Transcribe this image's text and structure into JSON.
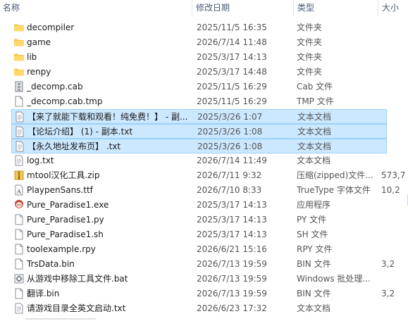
{
  "columns": {
    "name": "名称",
    "date": "修改日期",
    "type": "类型",
    "size": "大小"
  },
  "files": [
    {
      "name": "decompiler",
      "date": "2025/11/5 16:35",
      "type": "文件夹",
      "size": "",
      "icon": "folder-icon",
      "selected": false
    },
    {
      "name": "game",
      "date": "2026/7/14 11:48",
      "type": "文件夹",
      "size": "",
      "icon": "folder-icon",
      "selected": false
    },
    {
      "name": "lib",
      "date": "2025/3/17 14:13",
      "type": "文件夹",
      "size": "",
      "icon": "folder-icon",
      "selected": false
    },
    {
      "name": "renpy",
      "date": "2025/3/17 14:48",
      "type": "文件夹",
      "size": "",
      "icon": "folder-icon",
      "selected": false
    },
    {
      "name": "_decomp.cab",
      "date": "2025/11/5 16:29",
      "type": "Cab 文件",
      "size": "",
      "icon": "cab-archive-icon",
      "selected": false
    },
    {
      "name": "_decomp.cab.tmp",
      "date": "2025/11/5 16:29",
      "type": "TMP 文件",
      "size": "",
      "icon": "file-icon",
      "selected": false
    },
    {
      "name": "【来了就能下载和观看！纯免费！】 - 副...",
      "date": "2025/3/26 1:07",
      "type": "文本文档",
      "size": "",
      "icon": "text-document-icon",
      "selected": true
    },
    {
      "name": "【论坛介绍】 (1) - 副本.txt",
      "date": "2025/3/26 1:08",
      "type": "文本文档",
      "size": "",
      "icon": "text-document-icon",
      "selected": true
    },
    {
      "name": "【永久地址发布页】 .txt",
      "date": "2025/3/26 1:08",
      "type": "文本文档",
      "size": "",
      "icon": "text-document-icon",
      "selected": true
    },
    {
      "name": "log.txt",
      "date": "2026/7/14 11:49",
      "type": "文本文档",
      "size": "",
      "icon": "text-document-icon",
      "selected": false
    },
    {
      "name": "mtool汉化工具.zip",
      "date": "2026/7/11 9:32",
      "type": "压缩(zipped)文件...",
      "size": "573,7",
      "icon": "zip-folder-icon",
      "selected": false
    },
    {
      "name": "PlaypenSans.ttf",
      "date": "2026/7/10 8:33",
      "type": "TrueType 字体文件",
      "size": "10,2",
      "icon": "font-file-icon",
      "selected": false
    },
    {
      "name": "Pure_Paradise1.exe",
      "date": "2025/3/17 14:13",
      "type": "应用程序",
      "size": "",
      "icon": "app-character-icon",
      "selected": false
    },
    {
      "name": "Pure_Paradise1.py",
      "date": "2025/3/17 14:13",
      "type": "PY 文件",
      "size": "",
      "icon": "file-icon",
      "selected": false
    },
    {
      "name": "Pure_Paradise1.sh",
      "date": "2025/3/17 14:13",
      "type": "SH 文件",
      "size": "",
      "icon": "file-icon",
      "selected": false
    },
    {
      "name": "toolexample.rpy",
      "date": "2026/6/21 15:16",
      "type": "RPY 文件",
      "size": "",
      "icon": "file-icon",
      "selected": false
    },
    {
      "name": "TrsData.bin",
      "date": "2026/7/13 19:59",
      "type": "BIN 文件",
      "size": "3,2",
      "icon": "file-icon",
      "selected": false
    },
    {
      "name": "从游戏中移除工具文件.bat",
      "date": "2026/7/13 19:59",
      "type": "Windows 批处理...",
      "size": "",
      "icon": "batch-file-icon",
      "selected": false
    },
    {
      "name": "翻译.bin",
      "date": "2026/7/13 19:59",
      "type": "BIN 文件",
      "size": "3,2",
      "icon": "file-icon",
      "selected": false
    },
    {
      "name": "请游戏目录全英文启动.txt",
      "date": "2026/6/23 17:32",
      "type": "文本文档",
      "size": "",
      "icon": "text-document-icon",
      "selected": false
    }
  ]
}
